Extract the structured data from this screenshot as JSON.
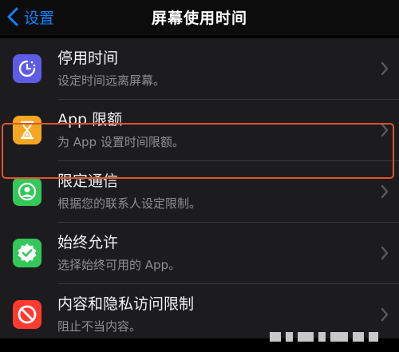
{
  "nav": {
    "back_label": "设置",
    "title": "屏幕使用时间"
  },
  "items": [
    {
      "title": "停用时间",
      "subtitle": "设定时间远离屏幕。",
      "icon": "downtime-icon",
      "color": "#5e5ce6"
    },
    {
      "title": "App 限额",
      "subtitle": "为 App 设置时间限额。",
      "icon": "hourglass-icon",
      "color": "#f5a623"
    },
    {
      "title": "限定通信",
      "subtitle": "根据您的联系人设定限制。",
      "icon": "contact-icon",
      "color": "#34c759",
      "highlighted": true
    },
    {
      "title": "始终允许",
      "subtitle": "选择始终可用的 App。",
      "icon": "checkmark-badge-icon",
      "color": "#34c759"
    },
    {
      "title": "内容和隐私访问限制",
      "subtitle": "阻止不当内容。",
      "icon": "restriction-icon",
      "color": "#ff3b30"
    }
  ],
  "colors": {
    "accent": "#0a84ff",
    "highlight_border": "#e0542a"
  }
}
